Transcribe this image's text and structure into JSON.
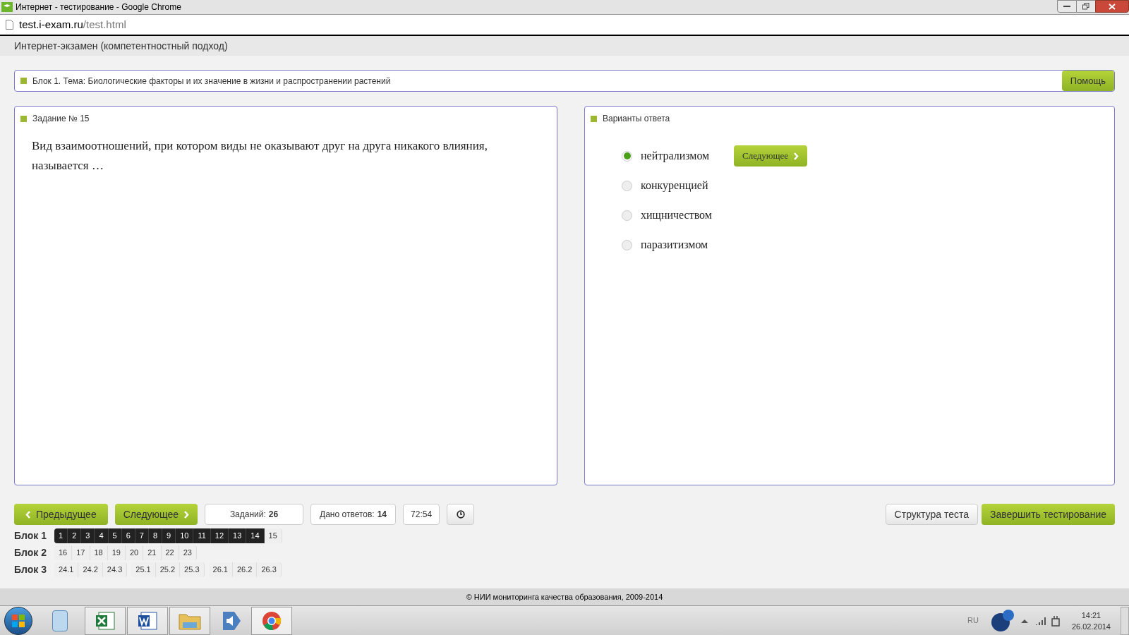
{
  "window": {
    "title": "Интернет - тестирование - Google Chrome"
  },
  "address_bar": {
    "host": "test.i-exam.ru",
    "path": "/test.html"
  },
  "page_header": "Интернет-экзамен (компетентностный подход)",
  "topic": {
    "text": "Блок 1. Тема: Биологические факторы и их значение в жизни и распространении растений",
    "help_button": "Помощь"
  },
  "task": {
    "title": "Задание № 15",
    "question": "Вид взаимоотношений, при котором виды не оказывают друг на друга никакого влияния, называется …"
  },
  "answers": {
    "title": "Варианты ответа",
    "next_button": "Следующее",
    "options": [
      {
        "label": "нейтрализмом",
        "selected": true
      },
      {
        "label": "конкуренцией",
        "selected": false
      },
      {
        "label": "хищничеством",
        "selected": false
      },
      {
        "label": "паразитизмом",
        "selected": false
      }
    ]
  },
  "controls": {
    "prev": "Предыдущее",
    "next": "Следующее",
    "tasks_label": "Заданий:",
    "tasks_count": "26",
    "answered_label": "Дано ответов:",
    "answered_count": "14",
    "timer": "72:54",
    "structure": "Структура теста",
    "finish": "Завершить тестирование"
  },
  "blocks": [
    {
      "label": "Блок 1",
      "groups": [
        [
          {
            "label": "1",
            "answered": true
          },
          {
            "label": "2",
            "answered": true
          },
          {
            "label": "3",
            "answered": true
          },
          {
            "label": "4",
            "answered": true
          },
          {
            "label": "5",
            "answered": true
          },
          {
            "label": "6",
            "answered": true
          },
          {
            "label": "7",
            "answered": true
          },
          {
            "label": "8",
            "answered": true
          },
          {
            "label": "9",
            "answered": true
          },
          {
            "label": "10",
            "answered": true
          },
          {
            "label": "11",
            "answered": true
          },
          {
            "label": "12",
            "answered": true
          },
          {
            "label": "13",
            "answered": true
          },
          {
            "label": "14",
            "answered": true
          },
          {
            "label": "15",
            "answered": false
          }
        ]
      ]
    },
    {
      "label": "Блок 2",
      "groups": [
        [
          {
            "label": "16",
            "answered": false
          },
          {
            "label": "17",
            "answered": false
          },
          {
            "label": "18",
            "answered": false
          },
          {
            "label": "19",
            "answered": false
          },
          {
            "label": "20",
            "answered": false
          },
          {
            "label": "21",
            "answered": false
          },
          {
            "label": "22",
            "answered": false
          },
          {
            "label": "23",
            "answered": false
          }
        ]
      ]
    },
    {
      "label": "Блок 3",
      "groups": [
        [
          {
            "label": "24.1",
            "answered": false
          },
          {
            "label": "24.2",
            "answered": false
          },
          {
            "label": "24.3",
            "answered": false
          }
        ],
        [
          {
            "label": "25.1",
            "answered": false
          },
          {
            "label": "25.2",
            "answered": false
          },
          {
            "label": "25.3",
            "answered": false
          }
        ],
        [
          {
            "label": "26.1",
            "answered": false
          },
          {
            "label": "26.2",
            "answered": false
          },
          {
            "label": "26.3",
            "answered": false
          }
        ]
      ]
    }
  ],
  "footer": "© НИИ мониторинга качества образования, 2009-2014",
  "taskbar": {
    "language": "RU",
    "time": "14:21",
    "date": "26.02.2014"
  }
}
